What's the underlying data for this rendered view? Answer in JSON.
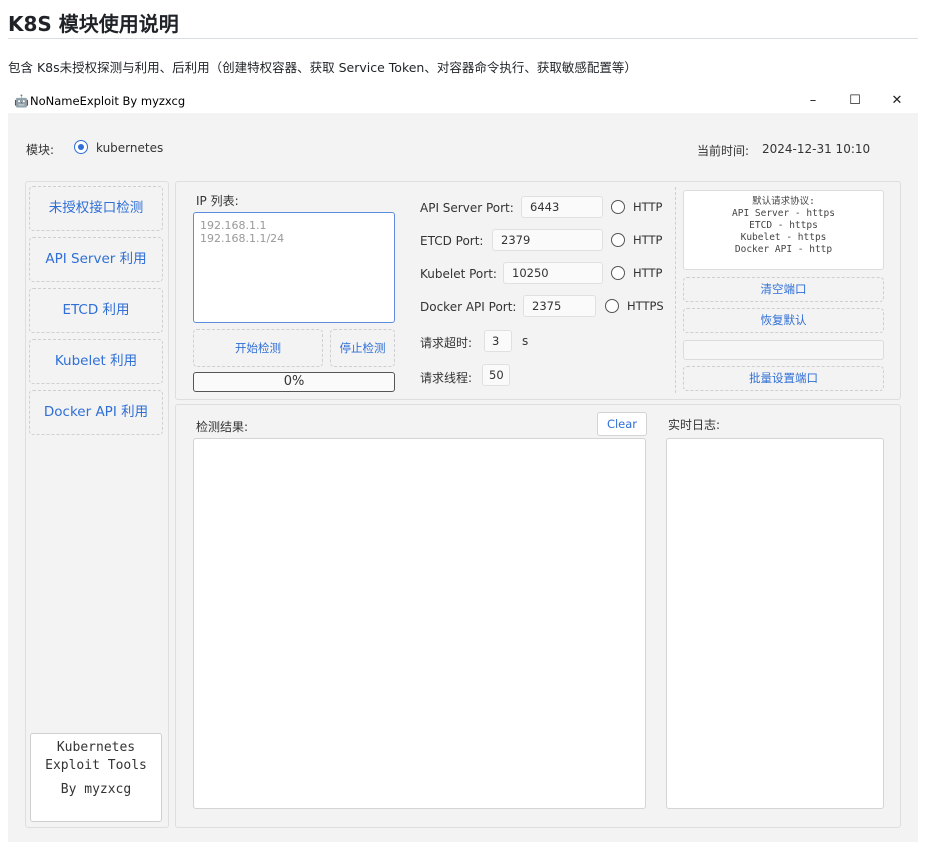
{
  "doc": {
    "title": "K8S 模块使用说明",
    "description": "包含 K8s未授权探测与利用、后利用（创建特权容器、获取 Service Token、对容器命令执行、获取敏感配置等）"
  },
  "window": {
    "icon": "robot-icon",
    "title": "NoNameExploit By myzxcg",
    "minimize": "–",
    "maximize": "☐",
    "close": "✕"
  },
  "header": {
    "module_label": "模块:",
    "module_option": "kubernetes",
    "time_label": "当前时间:",
    "time_value": "2024-12-31 10:10"
  },
  "sidebar": {
    "items": [
      {
        "label": "未授权接口检测"
      },
      {
        "label": "API Server 利用"
      },
      {
        "label": "ETCD 利用"
      },
      {
        "label": "Kubelet 利用"
      },
      {
        "label": "Docker API 利用"
      }
    ],
    "footer_lines": [
      "Kubernetes",
      "Exploit Tools",
      "By myzxcg"
    ]
  },
  "scan": {
    "ip_list_label": "IP 列表:",
    "ip_placeholder_lines": [
      "192.168.1.1",
      "192.168.1.1/24"
    ],
    "start_button": "开始检测",
    "stop_button": "停止检测",
    "progress_text": "0%",
    "progress_value": 0
  },
  "ports": [
    {
      "label": "API Server Port:",
      "value": "6443",
      "protocol": "HTTP"
    },
    {
      "label": "ETCD Port:",
      "value": "2379",
      "protocol": "HTTP"
    },
    {
      "label": "Kubelet Port:",
      "value": "10250",
      "protocol": "HTTP"
    },
    {
      "label": "Docker API Port:",
      "value": "2375",
      "protocol": "HTTPS"
    }
  ],
  "timeout": {
    "label": "请求超时:",
    "value": "3",
    "unit": "s"
  },
  "threads": {
    "label": "请求线程:",
    "value": "50"
  },
  "defaults": {
    "info_lines": [
      "默认请求协议:",
      "API Server - https",
      "ETCD - https",
      "Kubelet - https",
      "Docker API - http"
    ],
    "clear_ports": "清空端口",
    "restore_default": "恢复默认",
    "batch_input": "",
    "batch_set": "批量设置端口"
  },
  "results": {
    "label": "检测结果:",
    "clear_button": "Clear",
    "log_label": "实时日志:"
  },
  "colors": {
    "accent": "#2f6fd6",
    "window_bg": "#f3f3f3",
    "dashed_border": "#cfcfcf"
  }
}
